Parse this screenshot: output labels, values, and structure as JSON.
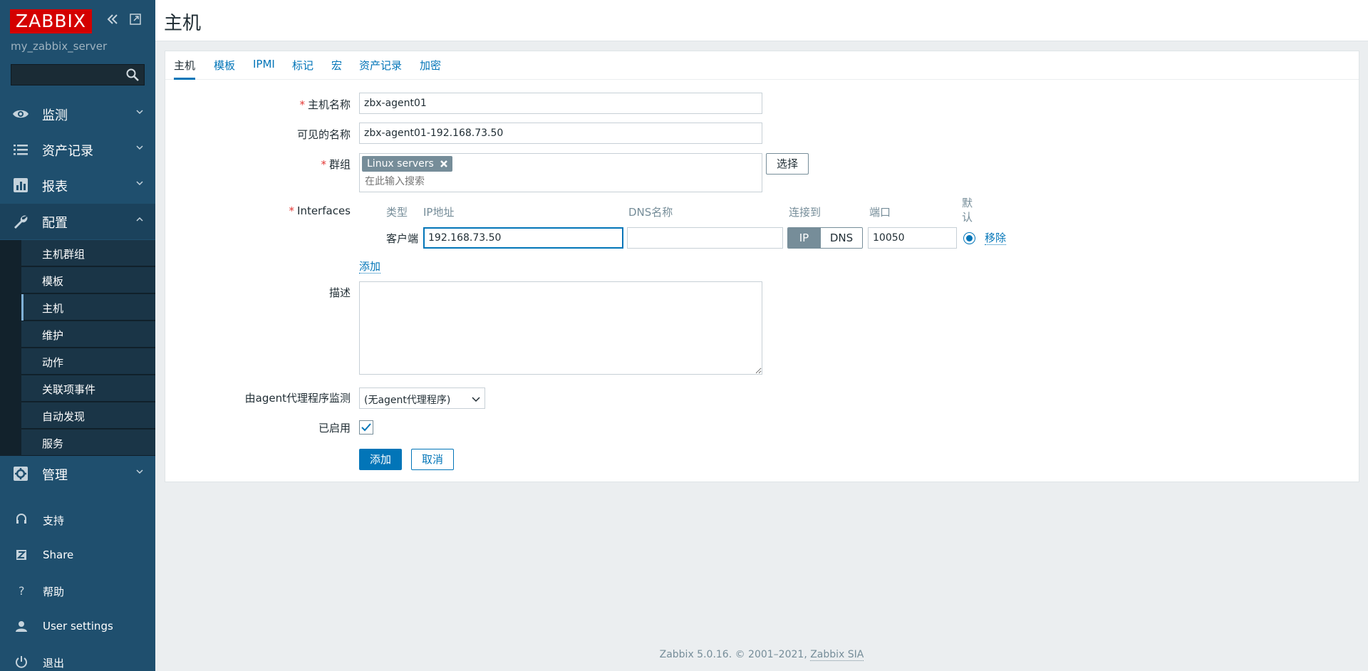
{
  "sidebar": {
    "logo": "ZABBIX",
    "server_name": "my_zabbix_server",
    "search": {
      "value": "",
      "placeholder": ""
    },
    "nav": [
      {
        "label": "监测",
        "icon": "eye-icon"
      },
      {
        "label": "资产记录",
        "icon": "list-icon"
      },
      {
        "label": "报表",
        "icon": "bar-chart-icon"
      },
      {
        "label": "配置",
        "icon": "wrench-icon"
      },
      {
        "label": "管理",
        "icon": "gear-icon"
      }
    ],
    "config_submenu": [
      "主机群组",
      "模板",
      "主机",
      "维护",
      "动作",
      "关联项事件",
      "自动发现",
      "服务"
    ],
    "utility": [
      {
        "label": "支持",
        "icon": "headset-icon"
      },
      {
        "label": "Share",
        "icon": "share-z-icon"
      },
      {
        "label": "帮助",
        "icon": "question-icon"
      },
      {
        "label": "User settings",
        "icon": "user-icon"
      },
      {
        "label": "退出",
        "icon": "power-icon"
      }
    ]
  },
  "header": {
    "title": "主机"
  },
  "tabs": [
    "主机",
    "模板",
    "IPMI",
    "标记",
    "宏",
    "资产记录",
    "加密"
  ],
  "form": {
    "host_name": {
      "label": "主机名称",
      "value": "zbx-agent01"
    },
    "visible_name": {
      "label": "可见的名称",
      "value": "zbx-agent01-192.168.73.50"
    },
    "groups": {
      "label": "群组",
      "tag": "Linux servers",
      "placeholder": "在此输入搜索",
      "select_button": "选择"
    },
    "interfaces": {
      "label": "Interfaces",
      "headers": {
        "type": "类型",
        "ip": "IP地址",
        "dns": "DNS名称",
        "connect": "连接到",
        "port": "端口",
        "default": "默认"
      },
      "rows": [
        {
          "type": "客户端",
          "ip": "192.168.73.50",
          "dns": "",
          "connect_ip": "IP",
          "connect_dns": "DNS",
          "port": "10050",
          "remove": "移除"
        }
      ],
      "add_link": "添加"
    },
    "description": {
      "label": "描述",
      "value": ""
    },
    "proxy": {
      "label": "由agent代理程序监测",
      "selected": "(无agent代理程序)"
    },
    "enabled": {
      "label": "已启用"
    },
    "buttons": {
      "add": "添加",
      "cancel": "取消"
    }
  },
  "footer": {
    "text": "Zabbix 5.0.16. © 2001–2021, ",
    "link": "Zabbix SIA"
  },
  "colors": {
    "sidebar": "#1f4f6e",
    "accent": "#0275b8",
    "logo": "#d40000",
    "required": "#e33734"
  }
}
